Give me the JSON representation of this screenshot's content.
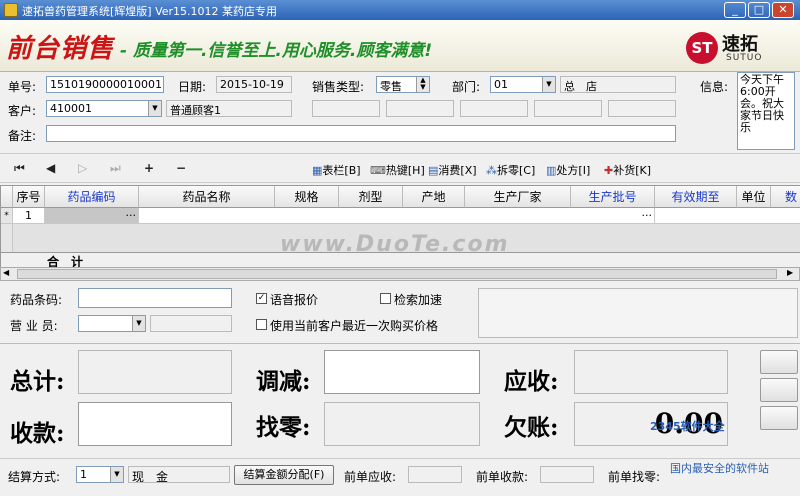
{
  "window": {
    "title": "速拓兽药管理系统[辉煌版] Ver15.1012    某药店专用"
  },
  "banner": {
    "title": "前台销售",
    "slogan": "- 质量第一.信誉至上.用心服务.顾客满意!",
    "logo_mark": "ST",
    "logo_cn": "速拓",
    "logo_en": "SUTUO"
  },
  "form": {
    "order_no_label": "单号:",
    "order_no": "1510190000010001",
    "date_label": "日期:",
    "date": "2015-10-19",
    "sale_type_label": "销售类型:",
    "sale_type": "零售",
    "dept_label": "部门:",
    "dept_code": "01",
    "dept_name": "总　店",
    "info_label": "信息:",
    "info_text": "今天下午6:00开会。祝大家节日快乐",
    "customer_label": "客户:",
    "customer_code": "410001",
    "customer_name": "普通顾客1",
    "remark_label": "备注:"
  },
  "toolbar": {
    "table_bar": "表栏[B]",
    "hotkey": "热键[H]",
    "consume": "消费[X]",
    "split": "拆零[C]",
    "prescription": "处方[I]",
    "restock": "补货[K]"
  },
  "grid": {
    "headers": [
      "序号",
      "药品编码",
      "药品名称",
      "规格",
      "剂型",
      "产地",
      "生产厂家",
      "生产批号",
      "有效期至",
      "单位",
      "数"
    ],
    "rows": [
      {
        "no": "1"
      }
    ],
    "total_label": "合　计"
  },
  "mid": {
    "barcode_label": "药品条码:",
    "salesperson_label": "营 业 员:",
    "voice_label": "语音报价",
    "voice_checked": true,
    "speed_label": "检索加速",
    "speed_checked": false,
    "last_price_label": "使用当前客户最近一次购买价格",
    "last_price_checked": false
  },
  "totals": {
    "total_label": "总计:",
    "adjust_label": "调减:",
    "receivable_label": "应收:",
    "received_label": "收款:",
    "change_label": "找零:",
    "owed_label": "欠账:",
    "owed_value": "0.00"
  },
  "footer": {
    "settle_label": "结算方式:",
    "settle_code": "1",
    "settle_name": "现　金",
    "distribute_button": "结算金额分配(F)",
    "prev_receivable_label": "前单应收:",
    "prev_received_label": "前单收款:",
    "prev_change_label": "前单找零:"
  },
  "watermark": {
    "main": "www.DuoTe.com",
    "site": "2345软件大全",
    "slogan": "国内最安全的软件站"
  }
}
